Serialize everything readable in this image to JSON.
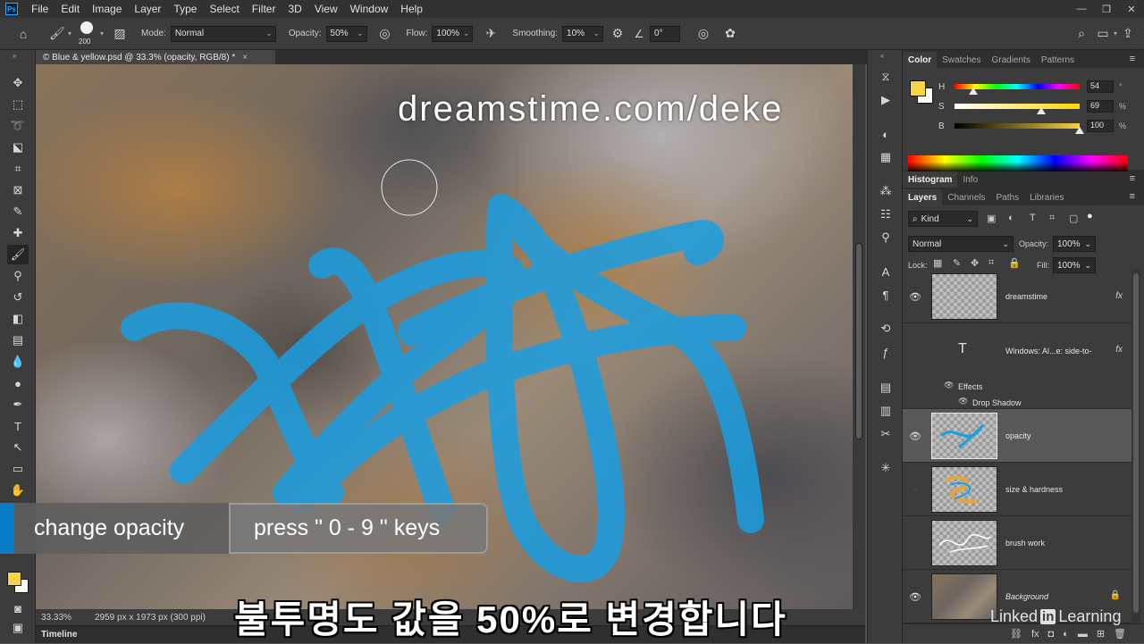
{
  "menu": {
    "items": [
      "File",
      "Edit",
      "Image",
      "Layer",
      "Type",
      "Select",
      "Filter",
      "3D",
      "View",
      "Window",
      "Help"
    ]
  },
  "options": {
    "brush_size": "200",
    "mode_label": "Mode:",
    "mode_value": "Normal",
    "opacity_label": "Opacity:",
    "opacity_value": "50%",
    "flow_label": "Flow:",
    "flow_value": "100%",
    "smoothing_label": "Smoothing:",
    "smoothing_value": "10%",
    "angle_value": "0°"
  },
  "document": {
    "tab_title": "© Blue & yellow.psd @ 33.3% (opacity, RGB/8) *",
    "zoom": "33.33%",
    "doc_size": "2959 px x 1973 px (300 ppi)"
  },
  "timeline_label": "Timeline",
  "color_panel": {
    "tabs": [
      "Color",
      "Swatches",
      "Gradients",
      "Patterns"
    ],
    "foreground_color": "#f6d445",
    "background_color": "#ffffff",
    "h_label": "H",
    "h_value": "54",
    "h_unit": "°",
    "h_fraction": 0.15,
    "s_label": "S",
    "s_value": "69",
    "s_unit": "%",
    "s_fraction": 0.69,
    "b_label": "B",
    "b_value": "100",
    "b_unit": "%",
    "b_fraction": 1.0
  },
  "histogram_tabs": [
    "Histogram",
    "Info"
  ],
  "layers_panel": {
    "tabs": [
      "Layers",
      "Channels",
      "Paths",
      "Libraries"
    ],
    "filter_kind": "Kind",
    "blend_mode": "Normal",
    "opacity_label": "Opacity:",
    "opacity_value": "100%",
    "lock_label": "Lock:",
    "fill_label": "Fill:",
    "fill_value": "100%",
    "layers": [
      {
        "name": "dreamstime",
        "visible": true,
        "fx": "fx"
      },
      {
        "name": "Windows: Al...e: side-to-",
        "visible": false,
        "fx": "fx",
        "type_layer": "T"
      },
      {
        "name": "opacity",
        "visible": true,
        "selected": true
      },
      {
        "name": "size & hardness",
        "visible": false
      },
      {
        "name": "brush work",
        "visible": false
      },
      {
        "name": "Background",
        "visible": true
      }
    ],
    "effects_label": "Effects",
    "drop_shadow_label": "Drop Shadow"
  },
  "brush_color": "#1a9ee2",
  "watermark_text": "dreamstime.com/deke",
  "caption": {
    "left": "change opacity",
    "right": "press \" 0 - 9 \" keys"
  },
  "subtitle": "불투명도 값을 50%로 변경합니다",
  "branding": {
    "prefix": "Linked",
    "in": "in",
    "suffix": "Learning"
  }
}
